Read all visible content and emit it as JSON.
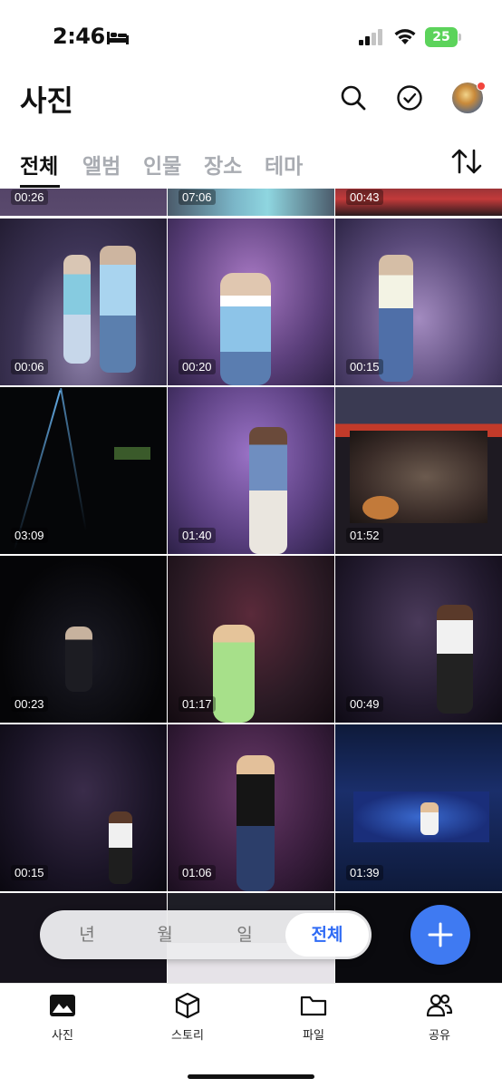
{
  "status": {
    "time": "2:46",
    "battery": "25"
  },
  "header": {
    "title": "사진"
  },
  "tabs": [
    "전체",
    "앨범",
    "인물",
    "장소",
    "테마"
  ],
  "grid": {
    "durations": [
      "00:26",
      "07:06",
      "00:43",
      "00:06",
      "00:20",
      "00:15",
      "03:09",
      "01:40",
      "01:52",
      "00:23",
      "01:17",
      "00:49",
      "00:15",
      "01:06",
      "01:39"
    ]
  },
  "segment": {
    "items": [
      "년",
      "월",
      "일",
      "전체"
    ],
    "selected": "전체"
  },
  "bottom_nav": {
    "items": [
      "사진",
      "스토리",
      "파일",
      "공유"
    ]
  },
  "colors": {
    "accent": "#3f7af2",
    "active_segment": "#2f6bf5",
    "tab_inactive": "#a9acb2"
  }
}
